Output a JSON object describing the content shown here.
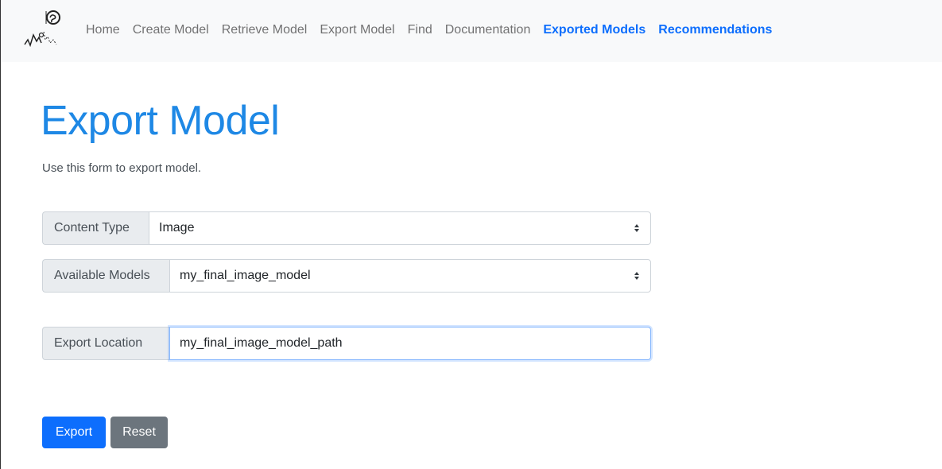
{
  "navbar": {
    "brand_icon": "brain-signal-logo-icon",
    "links": [
      {
        "label": "Home"
      },
      {
        "label": "Create Model"
      },
      {
        "label": "Retrieve Model"
      },
      {
        "label": "Export Model"
      },
      {
        "label": "Find"
      },
      {
        "label": "Documentation"
      },
      {
        "label": "Exported Models"
      },
      {
        "label": "Recommendations"
      }
    ]
  },
  "page": {
    "title": "Export Model",
    "lead": "Use this form to export model."
  },
  "form": {
    "content_type": {
      "label": "Content Type",
      "selected": "Image"
    },
    "available_models": {
      "label": "Available Models",
      "selected": "my_final_image_model"
    },
    "export_location": {
      "label": "Export Location",
      "value": "my_final_image_model_path"
    },
    "buttons": {
      "export": "Export",
      "reset": "Reset"
    }
  },
  "colors": {
    "accent": "#0d6efd",
    "title": "#1e88e5",
    "secondary": "#6c757d",
    "navbar_bg": "#f8f9fa"
  }
}
